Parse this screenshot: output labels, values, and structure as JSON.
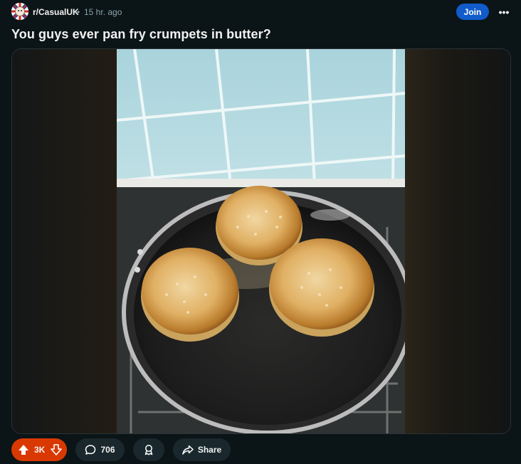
{
  "post": {
    "subreddit": "r/CasualUK",
    "separator": "•",
    "time": "15 hr. ago",
    "join_label": "Join",
    "more_label": "•••",
    "title": "You guys ever pan fry crumpets in butter?"
  },
  "actions": {
    "score": "3K",
    "comments": "706",
    "share_label": "Share"
  },
  "colors": {
    "background": "#0b1416",
    "join": "#115bca",
    "upvoted": "#d93900",
    "pill": "#1a282d"
  },
  "icons": [
    "subreddit-avatar",
    "more-icon",
    "upvote-icon",
    "downvote-icon",
    "comment-icon",
    "award-icon",
    "share-icon"
  ]
}
